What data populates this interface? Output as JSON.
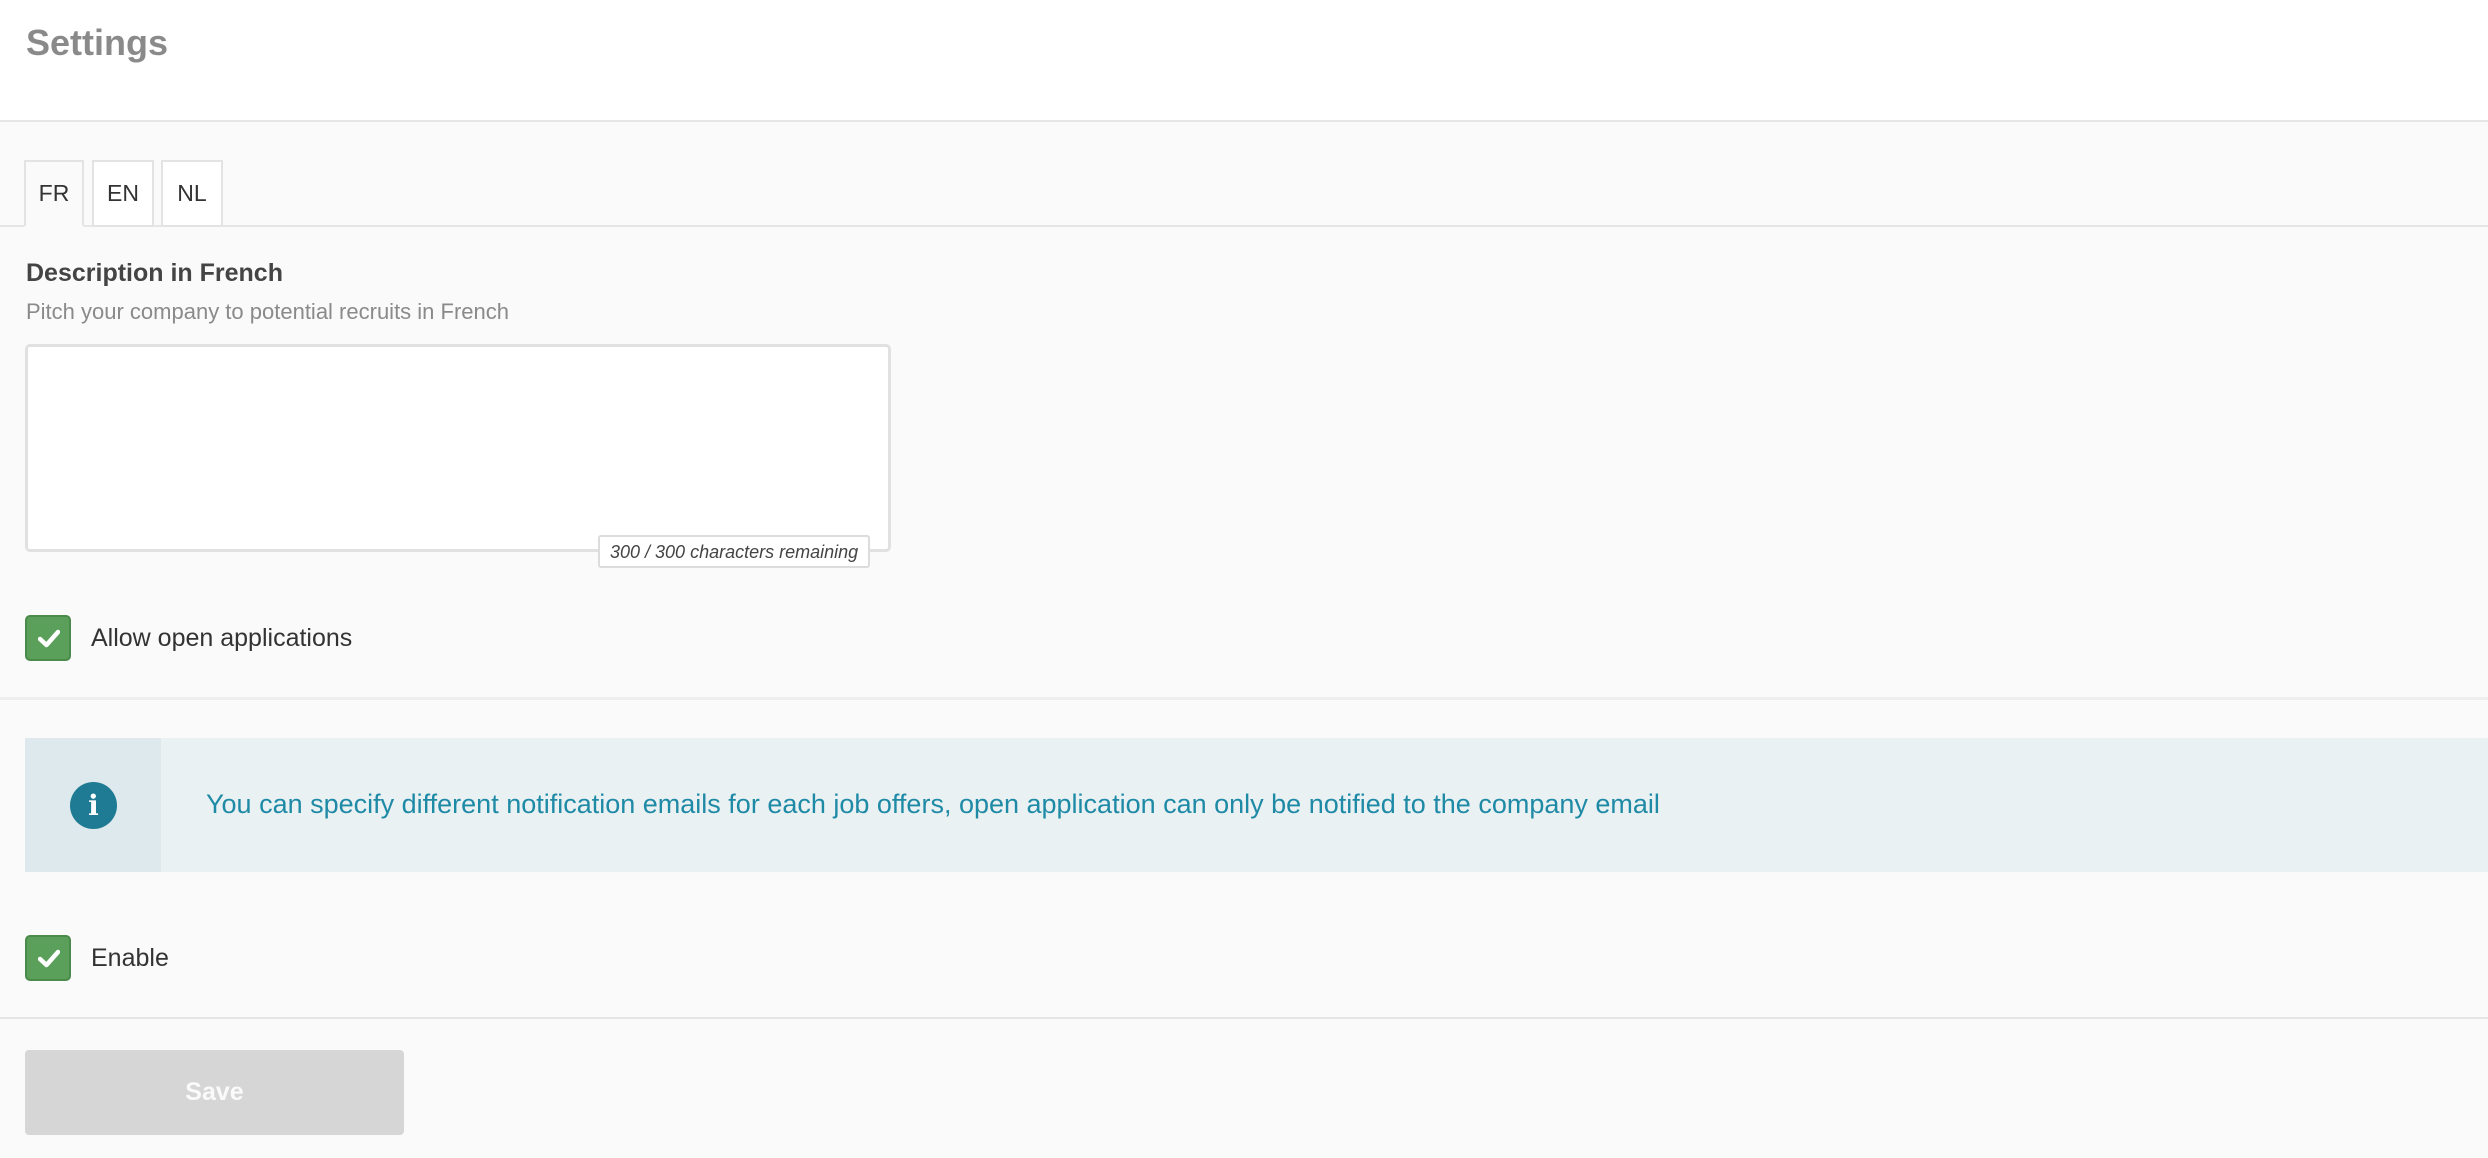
{
  "header": {
    "title": "Settings"
  },
  "tabs": [
    {
      "label": "FR",
      "active": true
    },
    {
      "label": "EN",
      "active": false
    },
    {
      "label": "NL",
      "active": false
    }
  ],
  "description": {
    "label": "Description in French",
    "help": "Pitch your company to potential recruits in French",
    "value": "",
    "counter": "300 / 300 characters remaining"
  },
  "open_applications": {
    "label": "Allow open applications",
    "checked": true
  },
  "info": {
    "icon": "info-icon",
    "glyph": "i",
    "text": "You can specify different notification emails for each job offers, open application can only be notified to the company email"
  },
  "enable": {
    "label": "Enable",
    "checked": true
  },
  "save": {
    "label": "Save"
  },
  "colors": {
    "checkbox": "#5aa05a",
    "info_text": "#1f8aa6",
    "info_icon": "#1f7a94",
    "save_disabled": "#d6d6d6"
  }
}
